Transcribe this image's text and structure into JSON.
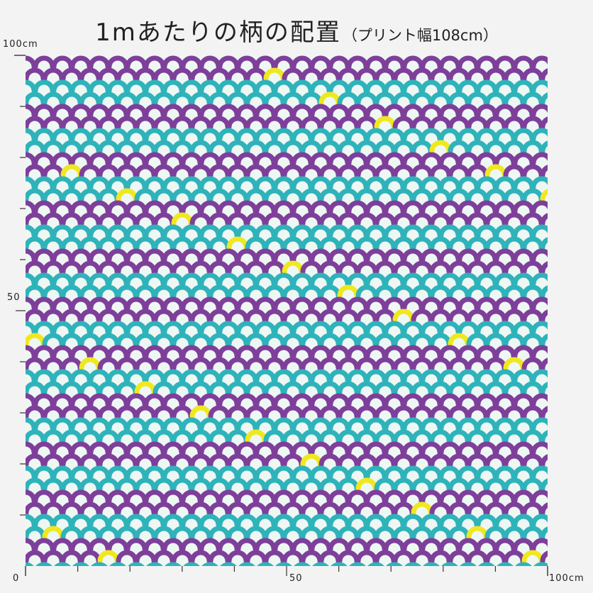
{
  "title": {
    "main": "1mあたりの柄の配置",
    "sub": "（プリント幅108cm）"
  },
  "y_axis": {
    "top_label": "100cm",
    "mid_label": "50"
  },
  "x_axis": {
    "start_label": "0",
    "mid_label": "50",
    "end_label": "100cm"
  },
  "pattern": {
    "background": "#eef7f4",
    "purple": "#7e3f9a",
    "teal": "#2fb3ba",
    "yellow": "#f0e81e"
  }
}
